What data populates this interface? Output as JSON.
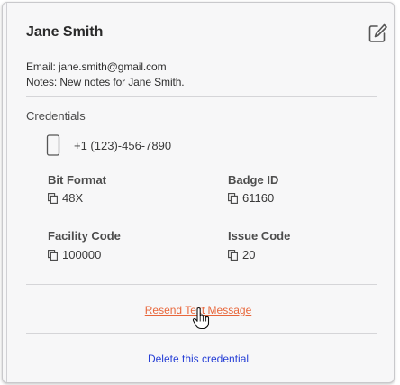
{
  "contact": {
    "name": "Jane Smith",
    "email_line": "Email: jane.smith@gmail.com",
    "notes_line": "Notes: New notes for Jane Smith."
  },
  "credentials": {
    "section_title": "Credentials",
    "phone": "+1 (123)-456-7890",
    "fields": [
      {
        "label": "Bit Format",
        "value": "48X"
      },
      {
        "label": "Badge ID",
        "value": "61160"
      },
      {
        "label": "Facility Code",
        "value": "100000"
      },
      {
        "label": "Issue Code",
        "value": "20"
      }
    ]
  },
  "actions": {
    "resend_label": "Resend Text Message",
    "delete_label": "Delete this credential"
  },
  "icons": {
    "edit": "edit-icon",
    "phone": "phone-icon",
    "copy": "copy-icon",
    "cursor": "hand-cursor-icon"
  },
  "colors": {
    "resend_link": "#e8663a",
    "delete_link": "#2740d6",
    "card_background": "#f7f7f8"
  }
}
